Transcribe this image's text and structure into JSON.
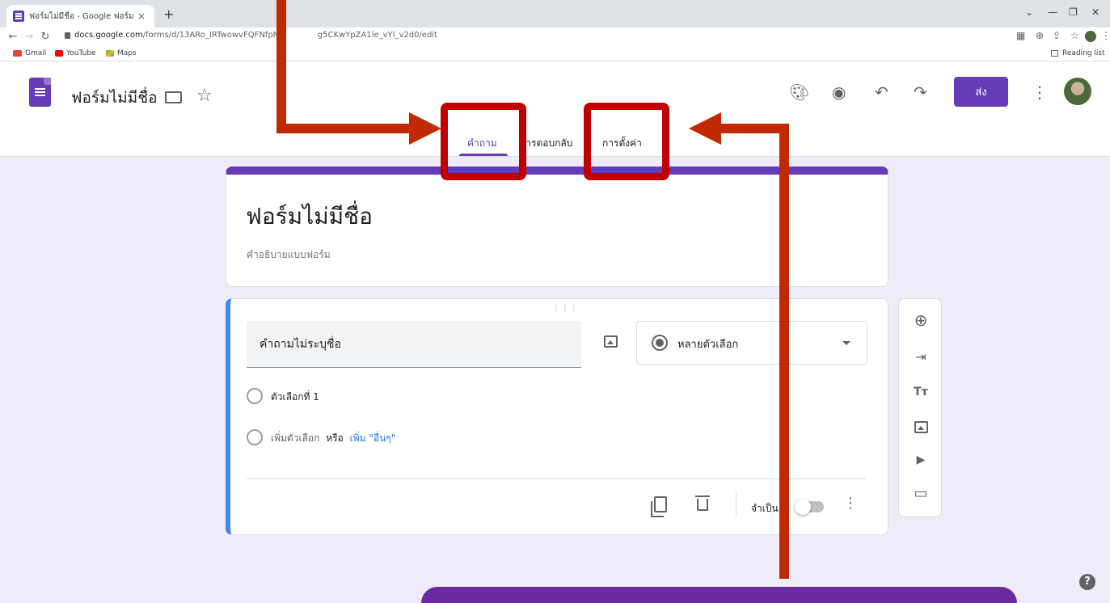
{
  "browser": {
    "tab_title": "ฟอร์มไม่มีชื่อ - Google ฟอร์ม",
    "tab_close": "×",
    "new_tab": "+",
    "url_host": "docs.google.com",
    "url_path": "/forms/d/13ARo_IRTwowvFQFNfpN-",
    "url_tail": "g5CKwYpZA1le_vYl_v2d0/edit",
    "bookmarks": [
      "Gmail",
      "YouTube",
      "Maps"
    ],
    "reading_list": "Reading list"
  },
  "forms_header": {
    "doc_title": "ฟอร์มไม่มีชื่อ",
    "send_label": "ส่ง",
    "tabs": [
      {
        "label": "คำถาม",
        "active": true
      },
      {
        "label": "การตอบกลับ",
        "active": false
      },
      {
        "label": "การตั้งค่า",
        "active": false
      }
    ]
  },
  "title_card": {
    "title": "ฟอร์มไม่มีชื่อ",
    "description": "คำอธิบายแบบฟอร์ม"
  },
  "question_card": {
    "question_text": "คำถามไม่ระบุชื่อ",
    "question_type": "หลายตัวเลือก",
    "option_1": "ตัวเลือกที่ 1",
    "add_option": "เพิ่มตัวเลือก",
    "or_text": "หรือ",
    "add_other": "เพิ่ม \"อื่นๆ\"",
    "required_label": "จำเป็น",
    "required_on": false
  },
  "help_label": "?",
  "colors": {
    "brand_purple": "#673ab7",
    "question_accent": "#4285f4",
    "background": "#f0ebf8",
    "annotation_red": "#c00000"
  }
}
